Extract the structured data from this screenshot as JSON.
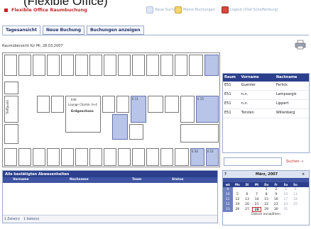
{
  "overlay_title": "(Flexible Office)",
  "header": {
    "title": "Flexible Office Raumbuchung",
    "links": [
      "Neue Suche",
      "Meine Buchungen",
      "Logout (Olaf Scheffenburg)"
    ]
  },
  "tabs": [
    "Tagesansicht",
    "Neue Buchung",
    "Buchungen anzeigen"
  ],
  "subtitle": "Raumübersicht für Mi, 28.03.2007",
  "floor": {
    "labels": [
      "Edit",
      "Lounge Charter 4+4",
      "Erdgeschoss",
      "Treffpunkt",
      "E 11",
      "E 15",
      "E 16",
      "E 50",
      "E 51",
      "E 61"
    ]
  },
  "room_table": {
    "columns": [
      "Raum",
      "Vorname",
      "Nachname"
    ],
    "rows": [
      [
        "E51",
        "Guenter",
        "Ferlick"
      ],
      [
        "E51",
        "n.n.",
        "Lampsargis"
      ],
      [
        "E51",
        "n.n.",
        "Lippert"
      ],
      [
        "E51",
        "Torsten",
        "Willenberg"
      ]
    ]
  },
  "search_button": "Suchen →",
  "absences": {
    "title": "Alle bestätigten Abwesenheiten",
    "columns": [
      "Vorname",
      "Nachname",
      "Team",
      "Status"
    ],
    "footer_left": "1 Zeile(n)",
    "footer_right": "1 Seite(n)"
  },
  "calendar": {
    "question": "?",
    "month": "März, 2007",
    "close": "×",
    "days": [
      "wk",
      "Mo",
      "Di",
      "Mi",
      "Do",
      "Fr",
      "Sa",
      "So"
    ],
    "weeks": [
      [
        "9",
        "",
        "",
        "",
        "1",
        "2",
        "3",
        "4"
      ],
      [
        "10",
        "5",
        "6",
        "7",
        "8",
        "9",
        "10",
        "11"
      ],
      [
        "11",
        "12",
        "13",
        "14",
        "15",
        "16",
        "17",
        "18"
      ],
      [
        "12",
        "19",
        "20",
        "21",
        "22",
        "23",
        "24",
        "25"
      ],
      [
        "13",
        "26",
        "27",
        "28",
        "29",
        "30",
        "31",
        ""
      ]
    ],
    "selected": "28",
    "footer": "Datum auswählen"
  },
  "colors": {
    "brand_red": "#c0282a",
    "header_blue": "#2b3f8c",
    "booked_room": "#b8c4e8"
  }
}
